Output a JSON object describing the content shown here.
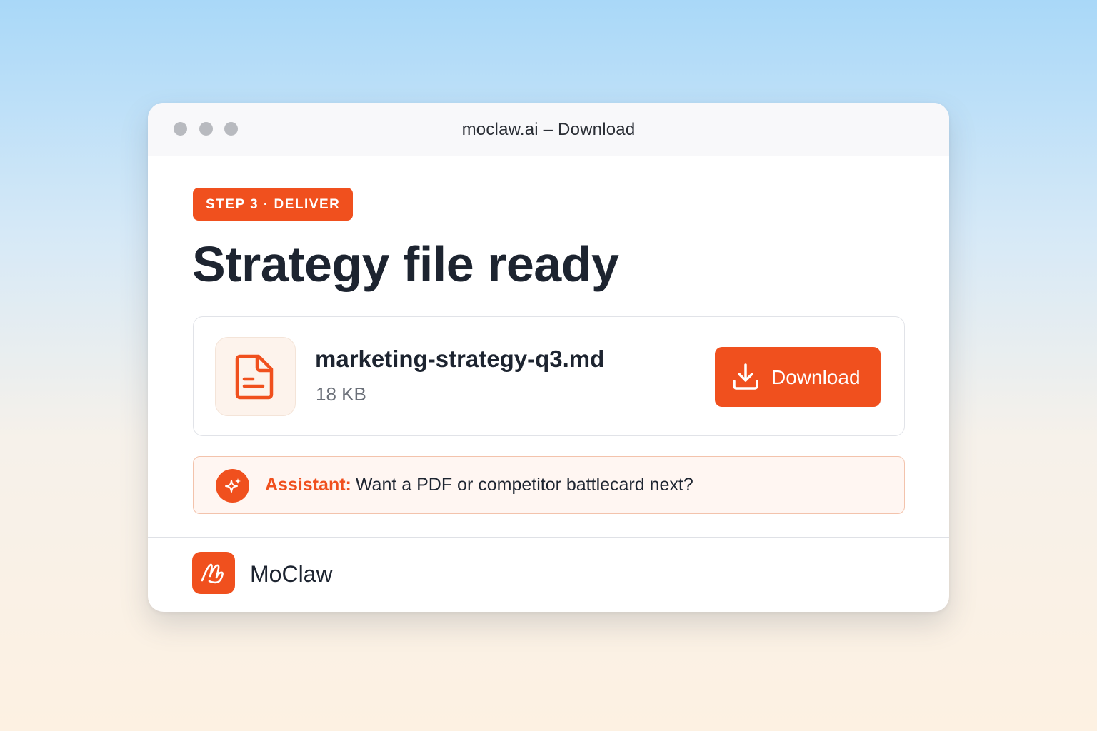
{
  "window": {
    "title": "moclaw.ai – Download"
  },
  "step_badge": "STEP 3 · DELIVER",
  "page_title": "Strategy file ready",
  "file": {
    "name": "marketing-strategy-q3.md",
    "size": "18 KB",
    "icon": "document-icon"
  },
  "download_button": {
    "label": "Download",
    "icon": "download-icon"
  },
  "assistant": {
    "label": "Assistant:",
    "message": "Want a PDF or competitor battlecard next?",
    "icon": "sparkle-icon"
  },
  "brand": {
    "name": "MoClaw",
    "icon": "moclaw-logo-icon"
  },
  "colors": {
    "accent": "#f0501e",
    "text": "#1d2430",
    "muted": "#6b7079"
  }
}
